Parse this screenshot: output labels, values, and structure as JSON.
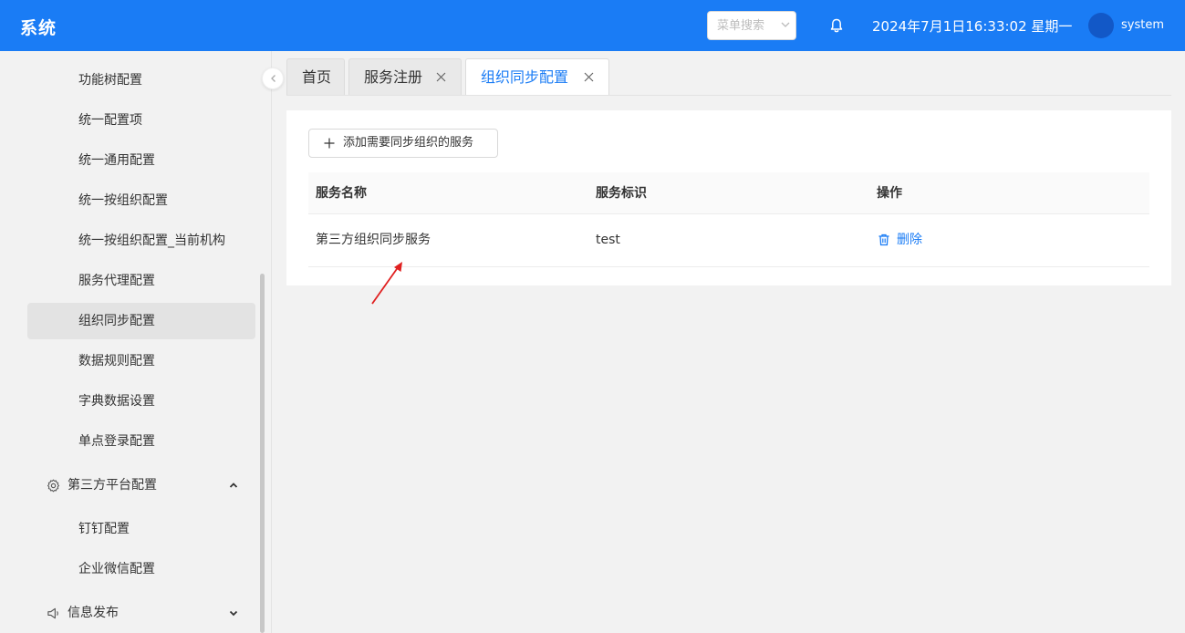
{
  "header": {
    "brand": "系统",
    "menu_search_placeholder": "菜单搜索",
    "datetime": "2024年7月1日16:33:02 星期一",
    "username": "system",
    "color": "#1a7cf5"
  },
  "sidebar": {
    "items": [
      {
        "label": "功能树配置"
      },
      {
        "label": "统一配置项"
      },
      {
        "label": "统一通用配置"
      },
      {
        "label": "统一按组织配置"
      },
      {
        "label": "统一按组织配置_当前机构"
      },
      {
        "label": "服务代理配置"
      },
      {
        "label": "组织同步配置",
        "active": true
      },
      {
        "label": "数据规则配置"
      },
      {
        "label": "字典数据设置"
      },
      {
        "label": "单点登录配置"
      }
    ],
    "group_third_party": {
      "label": "第三方平台配置",
      "icon": "gear-icon",
      "expanded": true
    },
    "third_party_items": [
      {
        "label": "钉钉配置"
      },
      {
        "label": "企业微信配置"
      }
    ],
    "group_info": {
      "label": "信息发布",
      "icon": "megaphone-icon",
      "expanded": false
    }
  },
  "tabs": [
    {
      "label": "首页",
      "closable": false
    },
    {
      "label": "服务注册",
      "closable": true
    },
    {
      "label": "组织同步配置",
      "closable": true,
      "active": true
    }
  ],
  "content": {
    "add_button_label": "添加需要同步组织的服务",
    "table": {
      "columns": [
        "服务名称",
        "服务标识",
        "操作"
      ],
      "rows": [
        {
          "name": "第三方组织同步服务",
          "id": "test",
          "action": "删除"
        }
      ]
    }
  }
}
